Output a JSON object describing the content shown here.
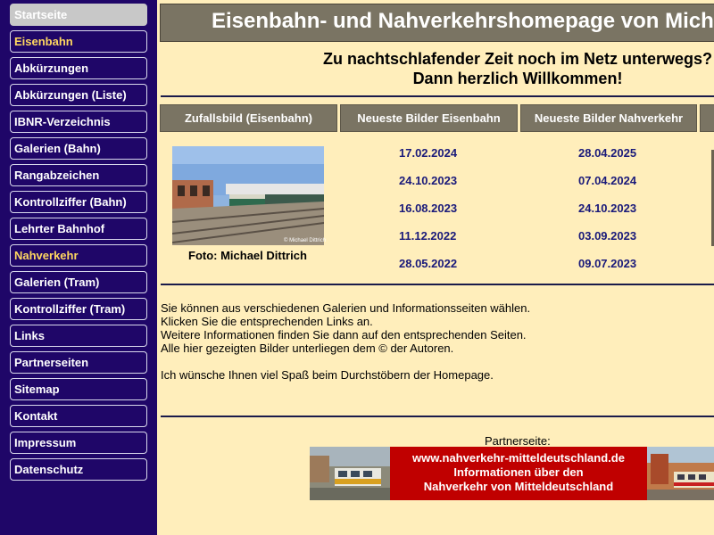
{
  "sidebar": {
    "items": [
      {
        "label": "Startseite",
        "state": "active"
      },
      {
        "label": "Eisenbahn",
        "state": "highlight"
      },
      {
        "label": "Abkürzungen",
        "state": ""
      },
      {
        "label": "Abkürzungen (Liste)",
        "state": ""
      },
      {
        "label": "IBNR-Verzeichnis",
        "state": ""
      },
      {
        "label": "Galerien (Bahn)",
        "state": ""
      },
      {
        "label": "Rangabzeichen",
        "state": ""
      },
      {
        "label": "Kontrollziffer (Bahn)",
        "state": ""
      },
      {
        "label": "Lehrter Bahnhof",
        "state": ""
      },
      {
        "label": "Nahverkehr",
        "state": "highlight"
      },
      {
        "label": "Galerien (Tram)",
        "state": ""
      },
      {
        "label": "Kontrollziffer (Tram)",
        "state": ""
      },
      {
        "label": "Links",
        "state": ""
      },
      {
        "label": "Partnerseiten",
        "state": ""
      },
      {
        "label": "Sitemap",
        "state": ""
      },
      {
        "label": "Kontakt",
        "state": ""
      },
      {
        "label": "Impressum",
        "state": ""
      },
      {
        "label": "Datenschutz",
        "state": ""
      }
    ]
  },
  "header": {
    "title": "Eisenbahn- und Nahverkehrshomepage von Mich"
  },
  "welcome": {
    "line1": "Zu nachtschlafender Zeit noch im Netz unterwegs?",
    "line2": "Dann herzlich Willkommen!"
  },
  "columns": {
    "random": "Zufallsbild (Eisenbahn)",
    "rail": "Neueste Bilder Eisenbahn",
    "tram": "Neueste Bilder Nahverkehr"
  },
  "rail_dates": [
    "17.02.2024",
    "24.10.2023",
    "16.08.2023",
    "11.12.2022",
    "28.05.2022"
  ],
  "tram_dates": [
    "28.04.2025",
    "07.04.2024",
    "24.10.2023",
    "03.09.2023",
    "09.07.2023"
  ],
  "photo": {
    "credit": "Foto: Michael Dittrich",
    "watermark": "© Michael Dittrich"
  },
  "info": {
    "lines": [
      "Sie können aus verschiedenen Galerien und Informationsseiten wählen.",
      "Klicken Sie die entsprechenden Links an.",
      "Weitere Informationen finden Sie dann auf den entsprechenden Seiten.",
      "Alle hier gezeigten Bilder unterliegen dem © der Autoren."
    ],
    "closing": "Ich wünsche Ihnen viel Spaß beim Durchstöbern der Homepage."
  },
  "partner": {
    "label": "Partnerseite:",
    "url": "www.nahverkehr-mitteldeutschland.de",
    "line2": "Informationen über den",
    "line3": "Nahverkehr von Mitteldeutschland"
  },
  "colors": {
    "sidebar_bg": "#1f0668",
    "page_bg": "#ffeebb",
    "header_bg": "#7a7463",
    "accent_yellow": "#ffd860",
    "partner_red": "#c00000",
    "date_blue": "#1a1a7a"
  }
}
